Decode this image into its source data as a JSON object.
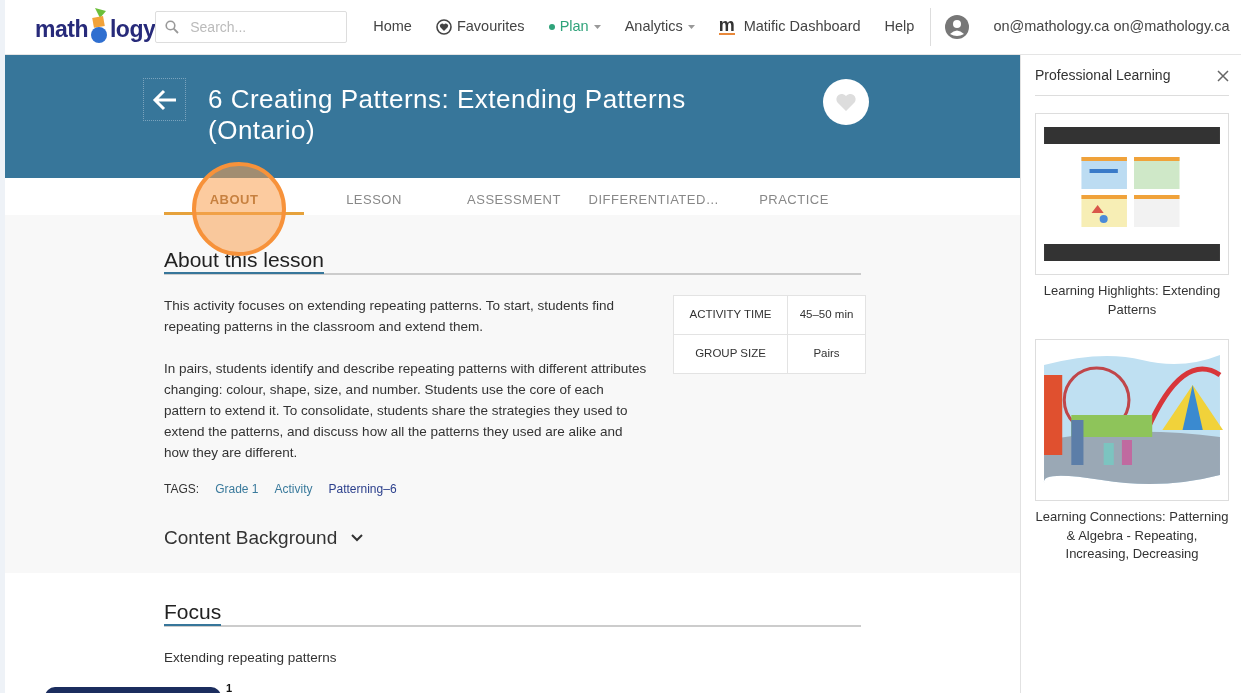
{
  "navbar": {
    "logo": {
      "before": "math",
      "after": "logy"
    },
    "search": {
      "placeholder": "Search..."
    },
    "items": [
      {
        "label": "Home",
        "kind": "plain"
      },
      {
        "label": "Favourites",
        "kind": "heart"
      },
      {
        "label": "Plan",
        "kind": "dot-dropdown"
      },
      {
        "label": "Analytics",
        "kind": "dropdown"
      },
      {
        "label": "Matific Dashboard",
        "kind": "glyph",
        "glyph": "m"
      },
      {
        "label": "Help",
        "kind": "plain"
      }
    ],
    "user": "on@mathology.ca on@mathology.ca"
  },
  "header": {
    "title": "6 Creating Patterns: Extending Patterns (Ontario)",
    "favourite": false
  },
  "tabs": [
    {
      "label": "ABOUT",
      "selected": true
    },
    {
      "label": "LESSON",
      "selected": false
    },
    {
      "label": "ASSESSMENT",
      "selected": false
    },
    {
      "label": "DIFFERENTIATED…",
      "selected": false
    },
    {
      "label": "PRACTICE",
      "selected": false
    }
  ],
  "about": {
    "heading": "About this lesson",
    "paragraphs": [
      "This activity focuses on extending repeating patterns. To start, students find repeating patterns in the classroom and extend them.",
      "In pairs, students identify and describe repeating patterns with different attributes changing: colour, shape, size, and number. Students use the core of each pattern to extend it. To consolidate, students share the strategies they used to extend the patterns, and discuss how all the patterns they used are alike and how they are different."
    ],
    "facts": [
      {
        "label": "ACTIVITY TIME",
        "value": "45–50 min"
      },
      {
        "label": "GROUP SIZE",
        "value": "Pairs"
      }
    ],
    "tags_label": "TAGS:",
    "tags": [
      {
        "label": "Grade 1",
        "color": "#3a7a9c"
      },
      {
        "label": "Activity",
        "color": "#3a7a9c"
      },
      {
        "label": "Patterning–6",
        "color": "#2b3f8c"
      }
    ],
    "content_background": {
      "label": "Content Background",
      "expanded": false
    }
  },
  "focus": {
    "heading": "Focus",
    "text": "Extending repeating patterns"
  },
  "floating_badge": "1",
  "panel": {
    "title": "Professional Learning",
    "items": [
      {
        "caption": "Learning Highlights: Extending Patterns",
        "kind": "slides"
      },
      {
        "caption": "Learning Connections: Patterning & Algebra - Repeating, Increasing, Decreasing",
        "kind": "fair"
      }
    ]
  }
}
